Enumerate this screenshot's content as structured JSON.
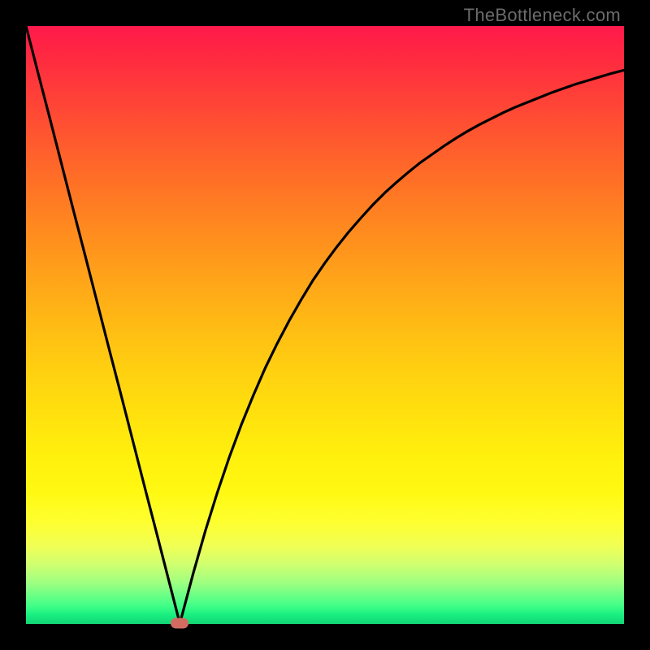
{
  "watermark": "TheBottleneck.com",
  "colors": {
    "frame": "#000000",
    "curve": "#000000",
    "marker": "#d46b63",
    "gradient_top": "#ff1a4d",
    "gradient_bottom": "#13d576"
  },
  "chart_data": {
    "type": "line",
    "title": "",
    "xlabel": "",
    "ylabel": "",
    "xlim": [
      0,
      100
    ],
    "ylim": [
      0,
      100
    ],
    "x": [
      0,
      2,
      4,
      6,
      8,
      10,
      12,
      14,
      16,
      18,
      20,
      22,
      24,
      25.7,
      26,
      28,
      30,
      32,
      34,
      36,
      38,
      40,
      42,
      44,
      46,
      48,
      50,
      52,
      54,
      56,
      58,
      60,
      62,
      64,
      66,
      68,
      70,
      72,
      74,
      76,
      78,
      80,
      82,
      84,
      86,
      88,
      90,
      92,
      94,
      96,
      98,
      100
    ],
    "y": [
      100,
      92.2,
      84.5,
      76.7,
      68.9,
      61.2,
      53.4,
      45.6,
      37.9,
      30.1,
      22.3,
      14.6,
      6.8,
      0.2,
      1.1,
      8.6,
      15.6,
      22.0,
      27.9,
      33.3,
      38.2,
      42.8,
      46.9,
      50.7,
      54.2,
      57.5,
      60.4,
      63.1,
      65.6,
      67.9,
      70.1,
      72.1,
      73.9,
      75.6,
      77.2,
      78.6,
      80.0,
      81.3,
      82.5,
      83.6,
      84.6,
      85.6,
      86.5,
      87.3,
      88.1,
      88.9,
      89.6,
      90.3,
      90.9,
      91.5,
      92.1,
      92.6
    ],
    "marker": {
      "x": 25.7,
      "y": 0.2
    },
    "annotations": [],
    "legend": []
  }
}
